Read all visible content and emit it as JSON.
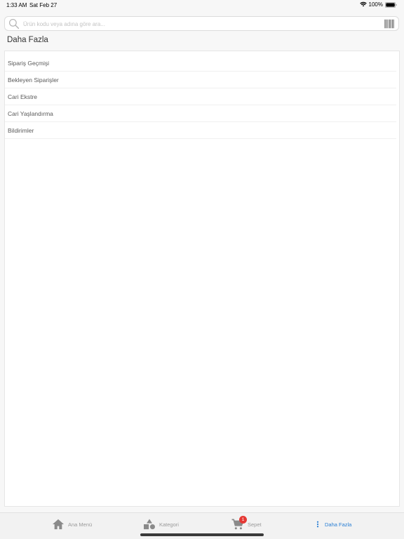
{
  "status_bar": {
    "time": "1:33 AM",
    "date": "Sat Feb 27",
    "battery": "100%"
  },
  "search": {
    "placeholder": "Ürün kodu veya adına göre ara..."
  },
  "page": {
    "title": "Daha Fazla"
  },
  "menu": {
    "items": [
      {
        "label": "Sipariş Geçmişi"
      },
      {
        "label": "Bekleyen Siparişler"
      },
      {
        "label": "Cari Ekstre"
      },
      {
        "label": "Cari Yaşlandırma"
      },
      {
        "label": "Bildirimler"
      }
    ]
  },
  "tab_bar": {
    "tabs": [
      {
        "label": "Ana Menü",
        "icon": "home-icon"
      },
      {
        "label": "Kategori",
        "icon": "shapes-icon"
      },
      {
        "label": "Sepet",
        "icon": "cart-icon",
        "badge": "1"
      },
      {
        "label": "Daha Fazla",
        "icon": "more-vertical-icon"
      }
    ],
    "active": "Daha Fazla"
  },
  "colors": {
    "accent": "#2a7fd4",
    "badge": "#e53935",
    "inactive": "#9a9a9a"
  }
}
